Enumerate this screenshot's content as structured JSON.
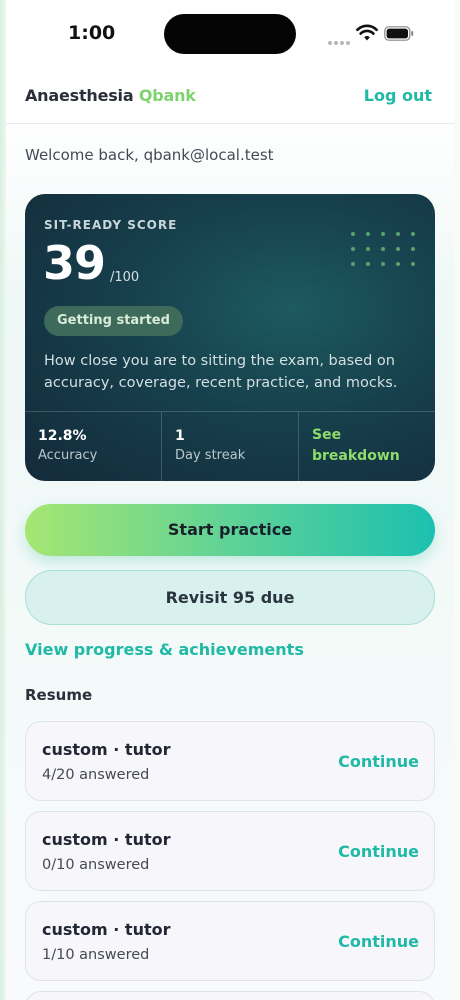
{
  "status": {
    "time": "1:00"
  },
  "header": {
    "brand_main": "Anaesthesia",
    "brand_accent": "Qbank",
    "logout_label": "Log out"
  },
  "welcome": "Welcome back, qbank@local.test",
  "score_card": {
    "label": "SIT-READY SCORE",
    "score": "39",
    "max": "/100",
    "badge": "Getting started",
    "description": "How close you are to sitting the exam, based on accuracy, coverage, recent practice, and mocks.",
    "stats": [
      {
        "value": "12.8%",
        "label": "Accuracy"
      },
      {
        "value": "1",
        "label": "Day streak"
      }
    ],
    "breakdown_link": "See breakdown"
  },
  "actions": {
    "start_label": "Start practice",
    "revisit_label": "Revisit 95 due",
    "progress_link": "View progress & achievements"
  },
  "resume": {
    "title": "Resume",
    "items": [
      {
        "title": "custom · tutor",
        "subtitle": "4/20 answered",
        "action": "Continue"
      },
      {
        "title": "custom · tutor",
        "subtitle": "0/10 answered",
        "action": "Continue"
      },
      {
        "title": "custom · tutor",
        "subtitle": "1/10 answered",
        "action": "Continue"
      }
    ]
  },
  "colors": {
    "accent": "#1fb9a6",
    "brand_green": "#7fd36f",
    "card_dark": "#163f4c"
  }
}
